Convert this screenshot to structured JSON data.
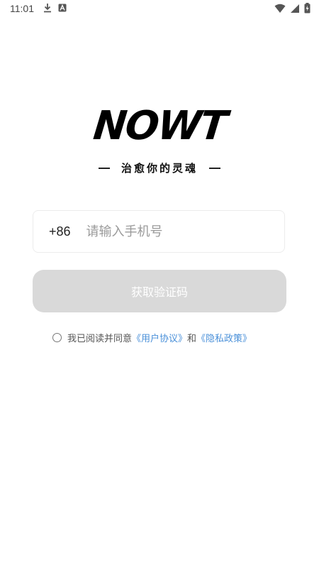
{
  "status_bar": {
    "time": "11:01",
    "left_icons": [
      "download-icon",
      "font-a-icon"
    ],
    "right_icons": [
      "wifi-icon",
      "signal-icon",
      "battery-charging-icon"
    ]
  },
  "brand": {
    "logo_text": "NOWT",
    "slogan": "治愈你的灵魂"
  },
  "phone_field": {
    "country_code": "+86",
    "placeholder": "请输入手机号",
    "value": ""
  },
  "get_code_button": {
    "label": "获取验证码"
  },
  "agreement": {
    "prefix": "我已阅读并同意",
    "user_agreement": "《用户协议》",
    "and": "和",
    "privacy_policy": "《隐私政策》",
    "checked": false
  },
  "colors": {
    "link": "#4a90d9",
    "button_disabled": "#d9d9d9",
    "input_border": "#ececec"
  }
}
